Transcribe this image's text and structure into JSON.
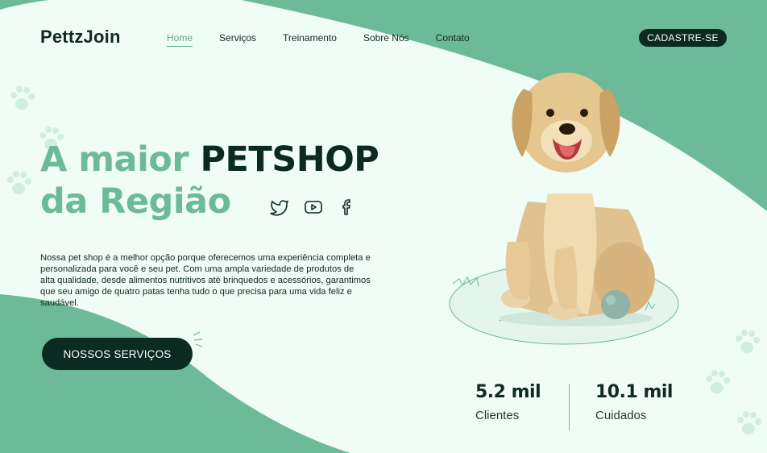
{
  "brand": {
    "logo": "PettzJoin"
  },
  "nav": {
    "items": [
      {
        "label": "Home",
        "active": true
      },
      {
        "label": "Serviços",
        "active": false
      },
      {
        "label": "Treinamento",
        "active": false
      },
      {
        "label": "Sobre Nós",
        "active": false
      },
      {
        "label": "Contato",
        "active": false
      }
    ],
    "signup_label": "CADASTRE-SE"
  },
  "hero": {
    "title_part1": "A maior ",
    "title_highlight": "PETSHOP",
    "title_line2": "da Região",
    "description": "Nossa pet shop é a melhor opção porque oferecemos uma experiência completa e personalizada para você e seu pet. Com uma ampla variedade de produtos de alta qualidade, desde alimentos nutritivos até brinquedos e acessórios, garantimos que seu amigo de quatro patas tenha tudo o que precisa para uma vida feliz e saudável.",
    "cta_label": "NOSSOS SERVIÇOS"
  },
  "social": [
    "twitter-icon",
    "youtube-icon",
    "facebook-icon"
  ],
  "stats": [
    {
      "value": "5.2 mil",
      "label": "Clientes"
    },
    {
      "value": "10.1 mil",
      "label": "Cuidados"
    }
  ],
  "colors": {
    "accent": "#6cba97",
    "dark": "#0b2a21",
    "background": "#f0fcf6"
  }
}
